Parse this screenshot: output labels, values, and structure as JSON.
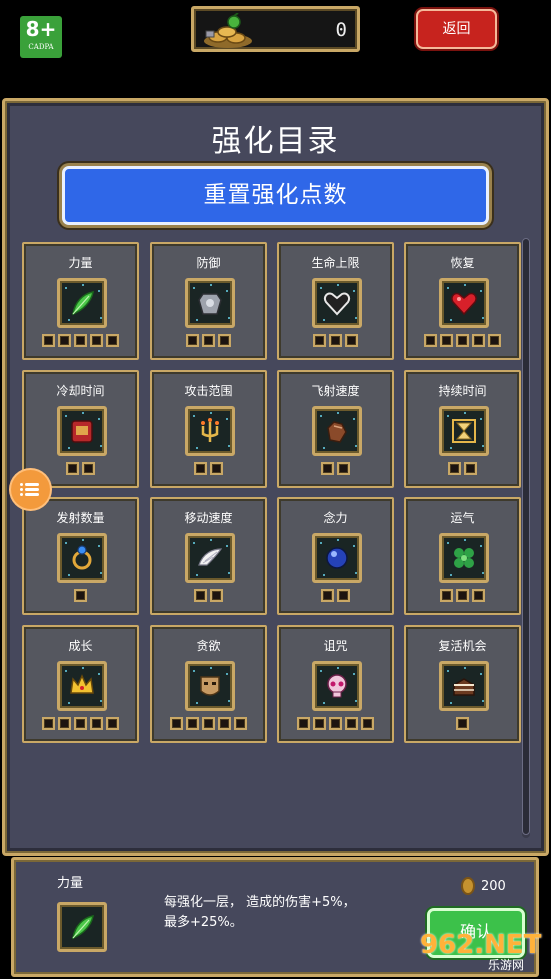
{
  "top": {
    "age_rating": "8+",
    "age_org": "CADPA",
    "gold_amount": "0",
    "back_label": "返回"
  },
  "panel": {
    "title": "强化目录",
    "reset_label": "重置强化点数"
  },
  "upgrades": [
    {
      "label": "力量",
      "icon": "leaf-icon",
      "pips": 5
    },
    {
      "label": "防御",
      "icon": "armor-icon",
      "pips": 3
    },
    {
      "label": "生命上限",
      "icon": "heart-outline-icon",
      "pips": 3
    },
    {
      "label": "恢复",
      "icon": "heart-icon",
      "pips": 5
    },
    {
      "label": "冷却时间",
      "icon": "tome-icon",
      "pips": 2
    },
    {
      "label": "攻击范围",
      "icon": "candelabra-icon",
      "pips": 2
    },
    {
      "label": "飞射速度",
      "icon": "gauntlet-icon",
      "pips": 2
    },
    {
      "label": "持续时间",
      "icon": "hourglass-icon",
      "pips": 2
    },
    {
      "label": "发射数量",
      "icon": "ring-icon",
      "pips": 1
    },
    {
      "label": "移动速度",
      "icon": "wings-icon",
      "pips": 2
    },
    {
      "label": "念力",
      "icon": "orb-icon",
      "pips": 2
    },
    {
      "label": "运气",
      "icon": "clover-icon",
      "pips": 3
    },
    {
      "label": "成长",
      "icon": "crown-icon",
      "pips": 5
    },
    {
      "label": "贪欲",
      "icon": "mask-icon",
      "pips": 5
    },
    {
      "label": "诅咒",
      "icon": "skull-icon",
      "pips": 5
    },
    {
      "label": "复活机会",
      "icon": "cake-icon",
      "pips": 1
    }
  ],
  "detail": {
    "title": "力量",
    "icon": "leaf-icon",
    "description_line1": "每强化一层， 造成的伤害+5%，",
    "description_line2": "最多+25%。",
    "cost": "200",
    "confirm_label": "确认"
  },
  "watermark": {
    "number": "962.NET",
    "text": "乐游网"
  },
  "colors": {
    "gold_border": "#c9a866",
    "panel_bg": "#46485c",
    "reset_blue": "#2f67e8",
    "back_red": "#c7231e",
    "confirm_green": "#3cc14a"
  }
}
